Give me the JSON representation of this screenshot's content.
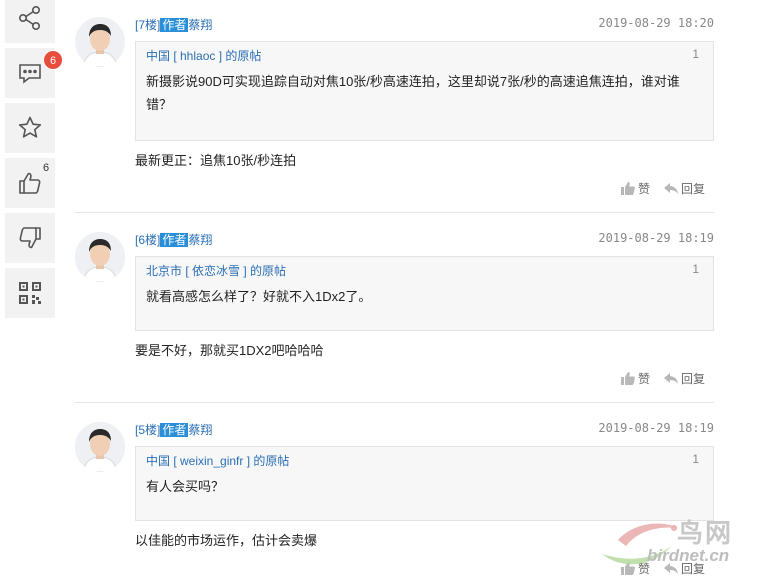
{
  "toolbar": {
    "items": [
      {
        "name": "share",
        "icon": "share-icon"
      },
      {
        "name": "comments",
        "icon": "chat-icon",
        "badge": "6"
      },
      {
        "name": "favorite",
        "icon": "star-icon"
      },
      {
        "name": "like",
        "icon": "thumbs-up-icon",
        "count": "6"
      },
      {
        "name": "dislike",
        "icon": "thumbs-down-icon"
      },
      {
        "name": "qrcode",
        "icon": "qrcode-icon"
      }
    ]
  },
  "comments": [
    {
      "floor": "[7楼]",
      "author_tag": "作者",
      "user": "蔡翔",
      "time": "2019-08-29 18:20",
      "quote_head": "中国 [ hhlaoc ] 的原帖",
      "quote_no": "1",
      "quote_body": "新摄影说90D可实现追踪自动对焦10张/秒高速连拍，这里却说7张/秒的高速追焦连拍，谁对谁错？",
      "reply": "最新更正：追焦10张/秒连拍",
      "like_label": "赞",
      "reply_label": "回复"
    },
    {
      "floor": "[6楼]",
      "author_tag": "作者",
      "user": "蔡翔",
      "time": "2019-08-29 18:19",
      "quote_head": "北京市 [ 依恋冰雪 ] 的原帖",
      "quote_no": "1",
      "quote_body": "就看高感怎么样了？好就不入1Dx2了。",
      "reply": "要是不好，那就买1DX2吧哈哈哈",
      "like_label": "赞",
      "reply_label": "回复"
    },
    {
      "floor": "[5楼]",
      "author_tag": "作者",
      "user": "蔡翔",
      "time": "2019-08-29 18:19",
      "quote_head": "中国 [ weixin_ginfr ] 的原帖",
      "quote_no": "1",
      "quote_body": "有人会买吗？",
      "reply": "以佳能的市场运作，估计会卖爆",
      "like_label": "赞",
      "reply_label": "回复"
    }
  ],
  "watermark": {
    "cn": "鸟网",
    "en": "birdnet.cn"
  },
  "colors": {
    "link": "#2a6fb5",
    "tag_bg": "#2a8fd8",
    "badge": "#e84c3d"
  }
}
